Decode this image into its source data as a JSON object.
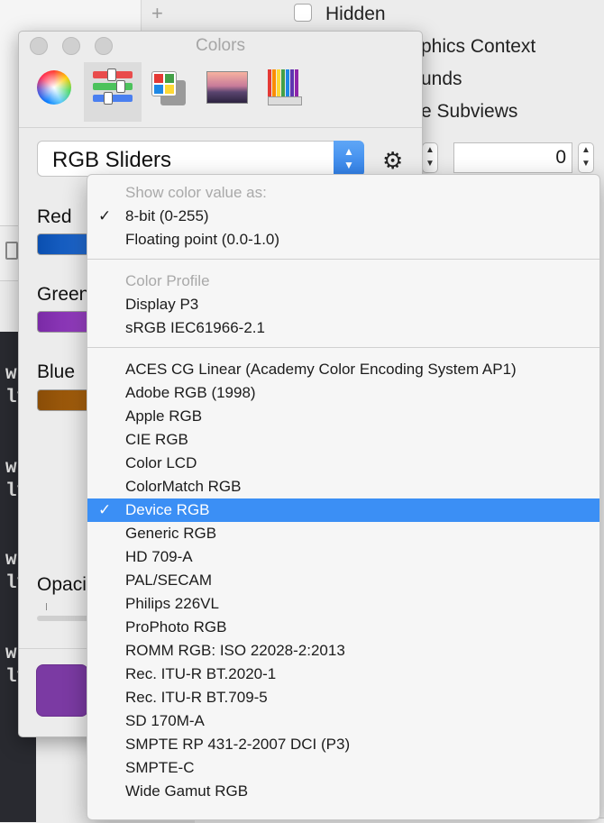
{
  "background": {
    "hidden_checkbox_label": "Hidden",
    "option_graphics_context": "phics Context",
    "option_bounds": "unds",
    "option_subviews": "e Subviews",
    "stepper_value": "0",
    "code_lines": [
      "w",
      "ly",
      "w",
      "ly",
      "w",
      "ly",
      "w",
      "ly"
    ]
  },
  "colors_panel": {
    "title": "Colors",
    "mode_select": "RGB Sliders",
    "channels": {
      "red": "Red",
      "green": "Green",
      "blue": "Blue",
      "opacity": "Opacity"
    },
    "swatch_color": "#7b3aa3",
    "channel_colors": {
      "red": [
        "#0a4fb0",
        "#2b76df"
      ],
      "green": [
        "#7a2aa6",
        "#a64bd1"
      ],
      "blue": [
        "#8a4d07",
        "#b66a10"
      ]
    }
  },
  "dropdown": {
    "sections": [
      {
        "header": "Show color value as:",
        "items": [
          {
            "label": "8-bit (0-255)",
            "checked": true
          },
          {
            "label": "Floating point (0.0-1.0)",
            "checked": false
          }
        ]
      },
      {
        "header": "Color Profile",
        "items": [
          {
            "label": "Display P3",
            "checked": false
          },
          {
            "label": "sRGB IEC61966-2.1",
            "checked": false
          }
        ]
      },
      {
        "header": "",
        "items": [
          {
            "label": "ACES CG Linear (Academy Color Encoding System AP1)",
            "checked": false
          },
          {
            "label": "Adobe RGB (1998)",
            "checked": false
          },
          {
            "label": "Apple RGB",
            "checked": false
          },
          {
            "label": "CIE RGB",
            "checked": false
          },
          {
            "label": "Color LCD",
            "checked": false
          },
          {
            "label": "ColorMatch RGB",
            "checked": false
          },
          {
            "label": "Device RGB",
            "checked": true,
            "highlighted": true
          },
          {
            "label": "Generic RGB",
            "checked": false
          },
          {
            "label": "HD 709-A",
            "checked": false
          },
          {
            "label": "PAL/SECAM",
            "checked": false
          },
          {
            "label": "Philips 226VL",
            "checked": false
          },
          {
            "label": "ProPhoto RGB",
            "checked": false
          },
          {
            "label": "ROMM RGB: ISO 22028-2:2013",
            "checked": false
          },
          {
            "label": "Rec. ITU-R BT.2020-1",
            "checked": false
          },
          {
            "label": "Rec. ITU-R BT.709-5",
            "checked": false
          },
          {
            "label": "SD 170M-A",
            "checked": false
          },
          {
            "label": "SMPTE RP 431-2-2007 DCI (P3)",
            "checked": false
          },
          {
            "label": "SMPTE-C",
            "checked": false
          },
          {
            "label": "Wide Gamut RGB",
            "checked": false
          }
        ]
      }
    ],
    "highlight_color": "#3b8ff5"
  }
}
